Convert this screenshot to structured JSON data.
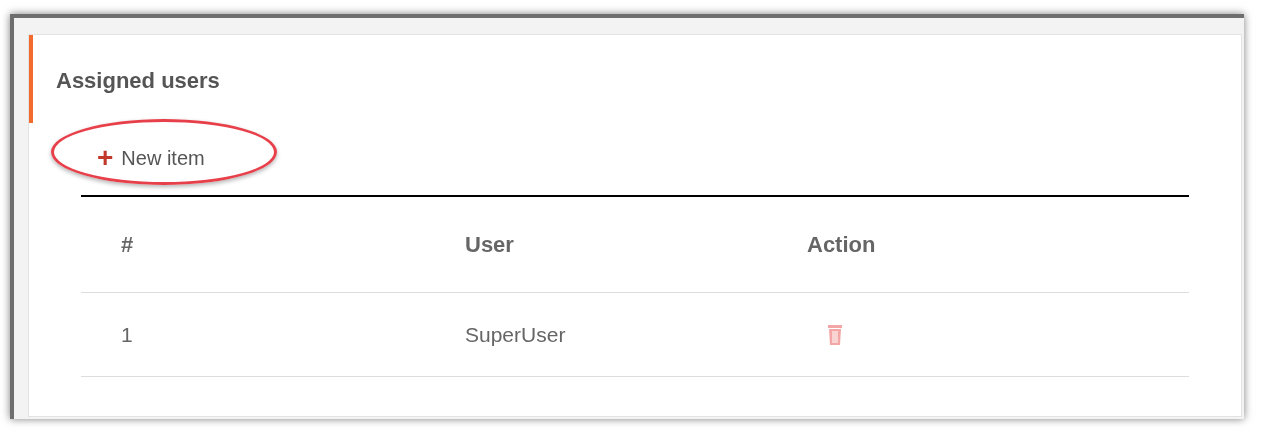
{
  "section": {
    "title": "Assigned users"
  },
  "new_item_button": {
    "icon": "+",
    "label": "New item",
    "highlighted": true
  },
  "table": {
    "columns": [
      "#",
      "User",
      "Action"
    ],
    "rows": [
      {
        "number": "1",
        "user": "SuperUser"
      }
    ]
  }
}
